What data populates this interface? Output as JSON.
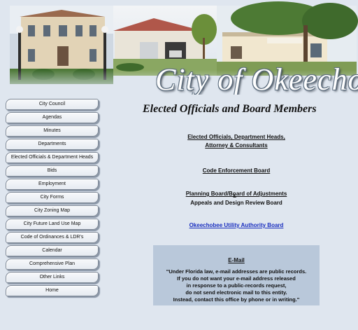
{
  "banner": {
    "title": "City of Okeechobee"
  },
  "nav": {
    "items": [
      {
        "id": "city-council",
        "label": "City Council"
      },
      {
        "id": "agendas",
        "label": "Agendas"
      },
      {
        "id": "minutes",
        "label": "Minutes"
      },
      {
        "id": "departments",
        "label": "Departments"
      },
      {
        "id": "elected-officials",
        "label": "Elected Officials & Department Heads"
      },
      {
        "id": "bids",
        "label": "Bids"
      },
      {
        "id": "employment",
        "label": "Employment"
      },
      {
        "id": "city-forms",
        "label": "City Forms"
      },
      {
        "id": "city-zoning-map",
        "label": "City Zoning Map"
      },
      {
        "id": "future-land-use-map",
        "label": "City Future Land Use Map"
      },
      {
        "id": "code-of-ordinances",
        "label": "Code of Ordinances & LDR's"
      },
      {
        "id": "calendar",
        "label": "Calendar"
      },
      {
        "id": "comprehensive-plan",
        "label": "Comprehensive Plan"
      },
      {
        "id": "other-links",
        "label": "Other Links"
      },
      {
        "id": "home",
        "label": "Home"
      }
    ]
  },
  "main": {
    "title": "Elected Officials and Board Members",
    "links": {
      "elected_line1": "Elected Officials, Department Heads,",
      "elected_line2": "Attorney & Consultants",
      "code_enforcement": "Code Enforcement Board",
      "planning_line1": "Planning Board/Board of Adjustments",
      "planning_amp": "&",
      "planning_line2": "Appeals and Design Review Board",
      "utility": "Okeechobee Utility Authority Board"
    }
  },
  "email_notice": {
    "title": "E-Mail",
    "line1": "\"Under Florida law, e-mail addresses are public records.",
    "line2": "If you do not want your e-mail address released",
    "line3": "in response to a public-records request,",
    "line4": "do not send electronic mail to this entity.",
    "line5": "Instead, contact this office by phone or in writing.\""
  },
  "colors": {
    "page_background": "#dfe6ef",
    "email_box": "#b9c8da",
    "utility_link": "#1a2fbf"
  }
}
